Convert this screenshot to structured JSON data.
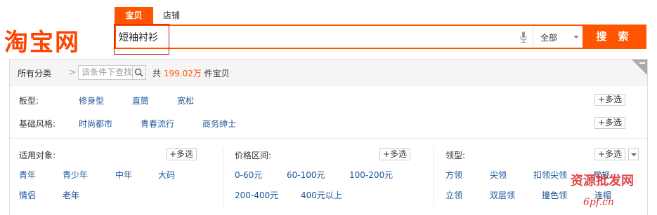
{
  "logo": {
    "text": "淘宝网"
  },
  "tabs": [
    {
      "label": "宝贝",
      "active": true
    },
    {
      "label": "店铺",
      "active": false
    }
  ],
  "search": {
    "value": "短袖衬衫",
    "category": "全部",
    "button_label": "搜 索"
  },
  "crumb": {
    "all_label": "所有分类",
    "arrow": ">",
    "filter_placeholder": "该条件下查找",
    "count_prefix": "共",
    "count_value": "199.02万",
    "count_suffix": "件宝贝"
  },
  "multi_label": "+多选",
  "filters": {
    "fit": {
      "label": "板型:",
      "options": [
        "修身型",
        "直筒",
        "宽松"
      ]
    },
    "style": {
      "label": "基础风格:",
      "options": [
        "时尚都市",
        "青春流行",
        "商务绅士"
      ]
    },
    "audience": {
      "label": "适用对象:",
      "options": [
        "青年",
        "青少年",
        "中年",
        "大码",
        "情侣",
        "老年"
      ]
    },
    "price": {
      "label": "价格区间:",
      "options": [
        "0-60元",
        "60-100元",
        "100-200元",
        "200-400元",
        "400元以上"
      ]
    },
    "collar": {
      "label": "领型:",
      "options": [
        "方领",
        "尖领",
        "扣领尖领",
        "常规",
        "立领",
        "双层领",
        "撞色领",
        "连帽"
      ]
    }
  },
  "watermark": {
    "line1": "资源批发网",
    "line2": "6pf.cn"
  },
  "colors": {
    "accent": "#ff5500",
    "link": "#1a5599"
  }
}
